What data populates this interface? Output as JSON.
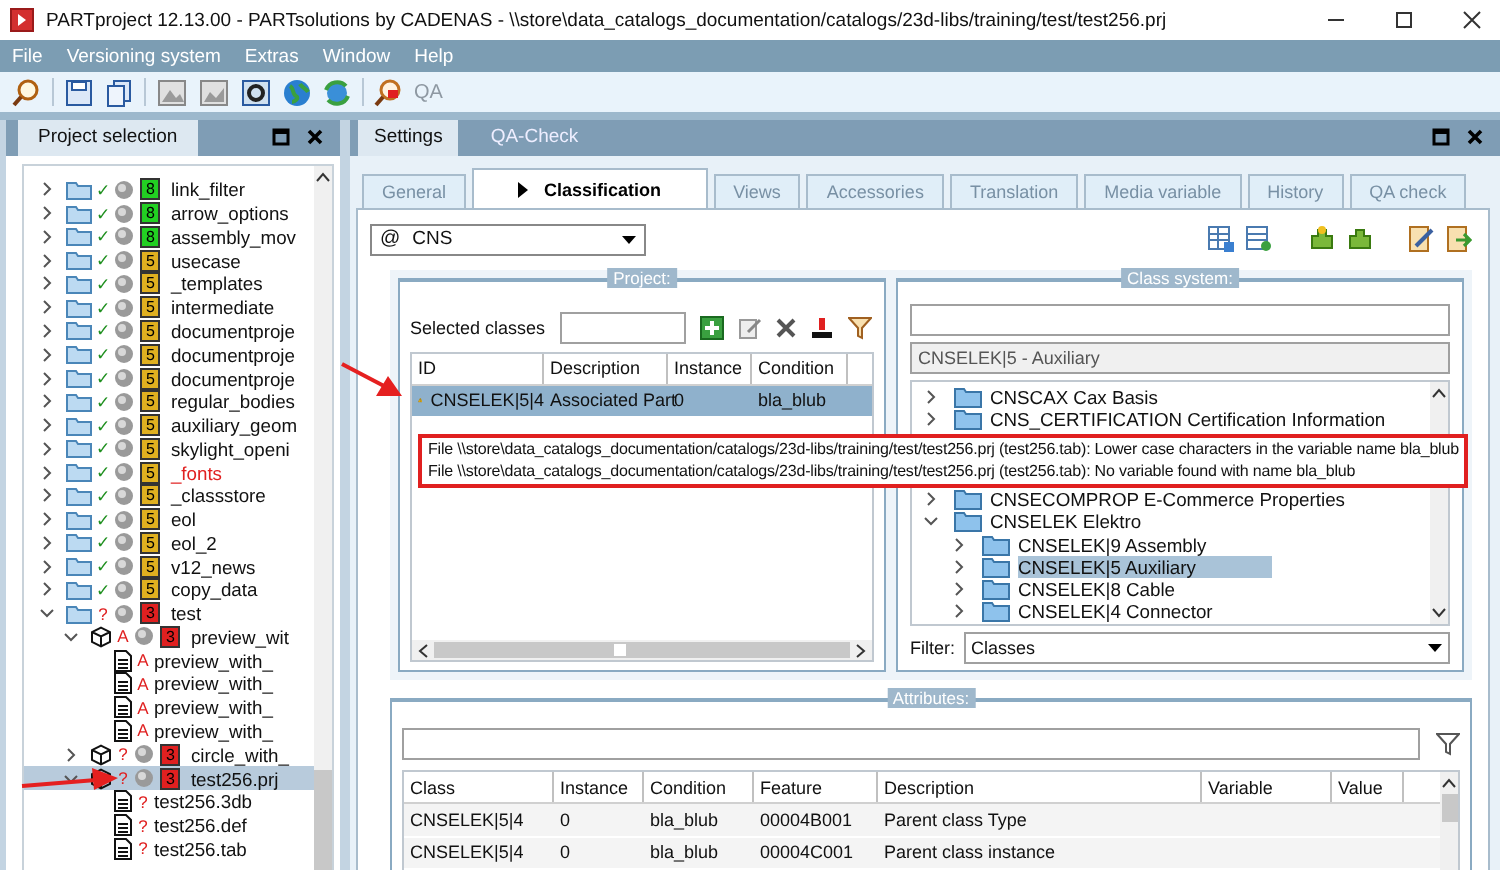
{
  "window": {
    "title": "PARTproject 12.13.00 - PARTsolutions by CADENAS - \\\\store\\data_catalogs_documentation/catalogs/23d-libs/training/test/test256.prj"
  },
  "menu": [
    "File",
    "Versioning system",
    "Extras",
    "Window",
    "Help"
  ],
  "toolbar": {
    "label": "QA",
    "label_disabled": true
  },
  "left_panel": {
    "title": "Project selection",
    "tree": [
      {
        "label": "link_filter",
        "kind": "folder",
        "status": "✓",
        "status_ok": true,
        "badge": "8",
        "color": "#22d022",
        "error": false,
        "expanded": false
      },
      {
        "label": "arrow_options",
        "kind": "folder",
        "status": "✓",
        "status_ok": true,
        "badge": "8",
        "color": "#22d022",
        "error": false,
        "expanded": false
      },
      {
        "label": "assembly_mov",
        "kind": "folder",
        "status": "✓",
        "status_ok": true,
        "badge": "8",
        "color": "#22d022",
        "error": false,
        "expanded": false
      },
      {
        "label": "usecase",
        "kind": "folder",
        "status": "✓",
        "status_ok": true,
        "badge": "5",
        "color": "#e0b020",
        "error": false,
        "expanded": false
      },
      {
        "label": "_templates",
        "kind": "folder",
        "status": "✓",
        "status_ok": true,
        "badge": "5",
        "color": "#e0b020",
        "error": false,
        "expanded": false
      },
      {
        "label": "intermediate",
        "kind": "folder",
        "status": "✓",
        "status_ok": true,
        "badge": "5",
        "color": "#e0b020",
        "error": false,
        "expanded": false
      },
      {
        "label": "documentproje",
        "kind": "folder",
        "status": "✓",
        "status_ok": true,
        "badge": "5",
        "color": "#e0b020",
        "error": false,
        "expanded": false
      },
      {
        "label": "documentproje",
        "kind": "folder",
        "status": "✓",
        "status_ok": true,
        "badge": "5",
        "color": "#e0b020",
        "error": false,
        "expanded": false
      },
      {
        "label": "documentproje",
        "kind": "folder",
        "status": "✓",
        "status_ok": true,
        "badge": "5",
        "color": "#e0b020",
        "error": false,
        "expanded": false
      },
      {
        "label": "regular_bodies",
        "kind": "folder",
        "status": "✓",
        "status_ok": true,
        "badge": "5",
        "color": "#e0b020",
        "error": false,
        "expanded": false
      },
      {
        "label": "auxiliary_geom",
        "kind": "folder",
        "status": "✓",
        "status_ok": true,
        "badge": "5",
        "color": "#e0b020",
        "error": false,
        "expanded": false
      },
      {
        "label": "skylight_openi",
        "kind": "folder",
        "status": "✓",
        "status_ok": true,
        "badge": "5",
        "color": "#e0b020",
        "error": false,
        "expanded": false
      },
      {
        "label": "_fonts",
        "kind": "folder",
        "status": "✓",
        "status_ok": true,
        "badge": "5",
        "color": "#e0b020",
        "error": true,
        "expanded": false
      },
      {
        "label": "_classstore",
        "kind": "folder",
        "status": "✓",
        "status_ok": true,
        "badge": "5",
        "color": "#e0b020",
        "error": false,
        "expanded": false
      },
      {
        "label": "eol",
        "kind": "folder",
        "status": "✓",
        "status_ok": true,
        "badge": "5",
        "color": "#e0b020",
        "error": false,
        "expanded": false
      },
      {
        "label": "eol_2",
        "kind": "folder",
        "status": "✓",
        "status_ok": true,
        "badge": "5",
        "color": "#e0b020",
        "error": false,
        "expanded": false
      },
      {
        "label": "v12_news",
        "kind": "folder",
        "status": "✓",
        "status_ok": true,
        "badge": "5",
        "color": "#e0b020",
        "error": false,
        "expanded": false
      },
      {
        "label": "copy_data",
        "kind": "folder",
        "status": "✓",
        "status_ok": true,
        "badge": "5",
        "color": "#e0b020",
        "error": false,
        "expanded": false
      },
      {
        "label": "test",
        "kind": "folder",
        "status": "?",
        "status_ok": false,
        "badge": "3",
        "color": "#e02020",
        "error": false,
        "expanded": true,
        "children": [
          {
            "label": "preview_wit",
            "kind": "cube",
            "status": "A",
            "status_ok": false,
            "badge": "3",
            "color": "#e02020",
            "error": false,
            "expanded": true,
            "children": [
              {
                "label": "preview_with_",
                "kind": "file",
                "status": "A",
                "status_ok": false,
                "error": false
              },
              {
                "label": "preview_with_",
                "kind": "file",
                "status": "A",
                "status_ok": false,
                "error": false
              },
              {
                "label": "preview_with_",
                "kind": "file",
                "status": "A",
                "status_ok": false,
                "error": false
              },
              {
                "label": "preview_with_",
                "kind": "file",
                "status": "A",
                "status_ok": false,
                "error": false
              }
            ]
          },
          {
            "label": "circle_with_",
            "kind": "cube",
            "status": "?",
            "status_ok": false,
            "badge": "3",
            "color": "#e02020",
            "error": false,
            "expanded": false
          },
          {
            "label": "test256.prj",
            "kind": "cube",
            "status": "?",
            "status_ok": false,
            "badge": "3",
            "color": "#e02020",
            "error": false,
            "expanded": true,
            "selected": true,
            "children": [
              {
                "label": "test256.3db",
                "kind": "file",
                "status": "?",
                "status_ok": false,
                "error": false
              },
              {
                "label": "test256.def",
                "kind": "file",
                "status": "?",
                "status_ok": false,
                "error": false
              },
              {
                "label": "test256.tab",
                "kind": "file",
                "status": "?",
                "status_ok": false,
                "error": false
              }
            ]
          }
        ]
      }
    ]
  },
  "main_tabs": [
    {
      "label": "Settings",
      "selected": true
    },
    {
      "label": "QA-Check",
      "selected": false
    }
  ],
  "settings_tabs": [
    {
      "label": "General",
      "selected": false
    },
    {
      "label": "Classification",
      "selected": true
    },
    {
      "label": "Views",
      "selected": false
    },
    {
      "label": "Accessories",
      "selected": false
    },
    {
      "label": "Translation",
      "selected": false
    },
    {
      "label": "Media variable",
      "selected": false
    },
    {
      "label": "History",
      "selected": false
    },
    {
      "label": "QA check",
      "selected": false
    }
  ],
  "class_combo": {
    "prefix": "@",
    "value": "CNS"
  },
  "project": {
    "title": "Project:",
    "selected_classes_label": "Selected classes",
    "columns": [
      "ID",
      "Description",
      "Instance",
      "Condition"
    ],
    "rows": [
      {
        "cells": [
          "CNSELEK|5|4",
          "Associated Part",
          "0",
          "bla_blub"
        ],
        "warning": true,
        "selected": true
      }
    ]
  },
  "tooltip": {
    "lines": [
      "File \\\\store\\data_catalogs_documentation/catalogs/23d-libs/training/test/test256.prj (test256.tab): Lower case characters in the variable name bla_blub",
      "File \\\\store\\data_catalogs_documentation/catalogs/23d-libs/training/test/test256.prj (test256.tab): No variable found with name bla_blub"
    ]
  },
  "class_system": {
    "title": "Class system:",
    "current": "CNSELEK|5 - Auxiliary",
    "tree": [
      {
        "label": "CNSCAX Cax Basis",
        "expanded": false
      },
      {
        "label": "CNS_CERTIFICATION Certification Information",
        "expanded": false
      },
      {
        "label": "CNSECOMPROP E-Commerce Properties",
        "expanded": false
      },
      {
        "label": "CNSELEK Elektro",
        "expanded": true,
        "children": [
          {
            "label": "CNSELEK|9 Assembly",
            "expanded": false,
            "selected": false
          },
          {
            "label": "CNSELEK|5 Auxiliary",
            "expanded": false,
            "selected": true
          },
          {
            "label": "CNSELEK|8 Cable",
            "expanded": false,
            "selected": false
          },
          {
            "label": "CNSELEK|4 Connector",
            "expanded": false,
            "selected": false
          }
        ]
      }
    ],
    "filter_label": "Filter:",
    "filter_value": "Classes"
  },
  "attributes": {
    "title": "Attributes:",
    "columns": [
      "Class",
      "Instance",
      "Condition",
      "Feature",
      "Description",
      "Variable",
      "Value"
    ],
    "rows": [
      {
        "cells": [
          "CNSELEK|5|4",
          "0",
          "bla_blub",
          "00004B001",
          "Parent class Type",
          "",
          ""
        ]
      },
      {
        "cells": [
          "CNSELEK|5|4",
          "0",
          "bla_blub",
          "00004C001",
          "Parent class instance",
          "",
          ""
        ]
      }
    ]
  }
}
